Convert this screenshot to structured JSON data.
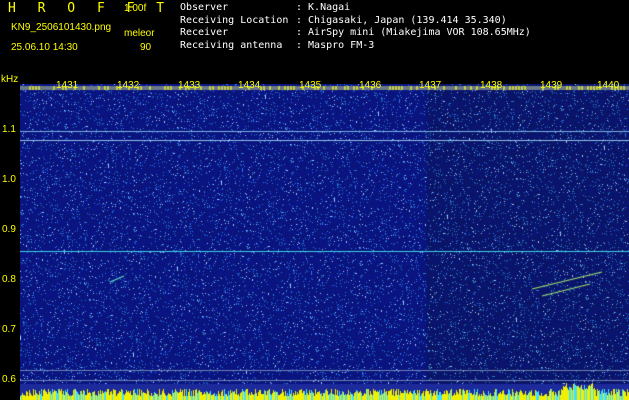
{
  "header": {
    "brand": "H R O F F T",
    "version": "1.00f",
    "filename": "KN9_2506101430.png",
    "mode": "meleor",
    "datetime": "25.06.10 14:30",
    "value": "90"
  },
  "info": [
    {
      "label": "Observer",
      "value": ": K.Nagai"
    },
    {
      "label": "Receiving Location",
      "value": ": Chigasaki, Japan (139.414 35.340)"
    },
    {
      "label": "Receiver",
      "value": ": AirSpy mini (Miakejima VOR 108.65MHz)"
    },
    {
      "label": "Receiving antenna",
      "value": ": Maspro FM-3"
    }
  ],
  "axis": {
    "y_unit": "kHz",
    "y_ticks": [
      "1.1",
      "1.0",
      "0.9",
      "0.8",
      "0.7",
      "0.6"
    ],
    "x_ticks": [
      "1431",
      "1432",
      "1433",
      "1434",
      "1435",
      "1436",
      "1437",
      "1438",
      "1439",
      "1440"
    ]
  },
  "colors": {
    "label": "#ffff00",
    "text": "#ffffff",
    "background": "#0a1670",
    "carrier": "#40d0e0"
  }
}
